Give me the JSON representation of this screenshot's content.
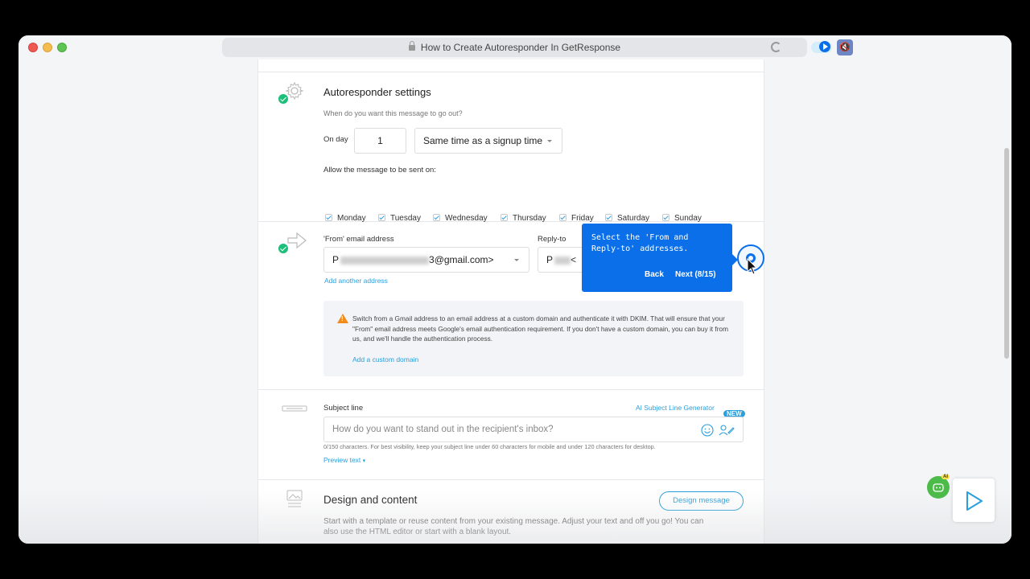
{
  "browser": {
    "title": "How to Create Autoresponder In GetResponse",
    "ext_icon": "speaker-muted-icon"
  },
  "autoresponder": {
    "title": "Autoresponder settings",
    "question": "When do you want this message to go out?",
    "on_day_label": "On day",
    "day_value": "1",
    "time_option": "Same time as a signup time",
    "allow_label": "Allow the message to be sent on:",
    "days": [
      "Monday",
      "Tuesday",
      "Wednesday",
      "Thursday",
      "Friday",
      "Saturday",
      "Sunday"
    ]
  },
  "from": {
    "label": "'From' email address",
    "value_prefix": "P",
    "value_suffix": "3@gmail.com>",
    "add_another": "Add another address",
    "reply_label": "Reply-to",
    "reply_value_prefix": "P",
    "reply_value_suffix": "<"
  },
  "warning": {
    "text": "Switch from a Gmail address to an email address at a custom domain and authenticate it with DKIM. That will ensure that your \"From\" email address meets Google's email authentication requirement. If you don't have a custom domain, you can buy it from us, and we'll handle the authentication process.",
    "link": "Add a custom domain"
  },
  "tooltip": {
    "text_line1": "Select the 'From and",
    "text_line2": "Reply-to' addresses.",
    "back": "Back",
    "next": "Next (8/15)"
  },
  "subject": {
    "label": "Subject line",
    "ai_link": "AI Subject Line Generator",
    "ai_badge": "NEW",
    "placeholder": "How do you want to stand out in the recipient's inbox?",
    "hint": "0/150 characters. For best visibility, keep your subject line under 60 characters for mobile and under 120 characters for desktop.",
    "preview": "Preview text"
  },
  "design": {
    "title": "Design and content",
    "button": "Design message",
    "desc_line1": "Start with a template or reuse content from your existing message. Adjust your text and off you go! You can",
    "desc_line2": "also use the HTML editor or start with a blank layout."
  },
  "assistant": {
    "badge": "AI"
  },
  "colors": {
    "accent": "#2b9fdc",
    "tooltip": "#0a6fe8",
    "success": "#1bbf7a",
    "warning": "#f28b1a"
  }
}
